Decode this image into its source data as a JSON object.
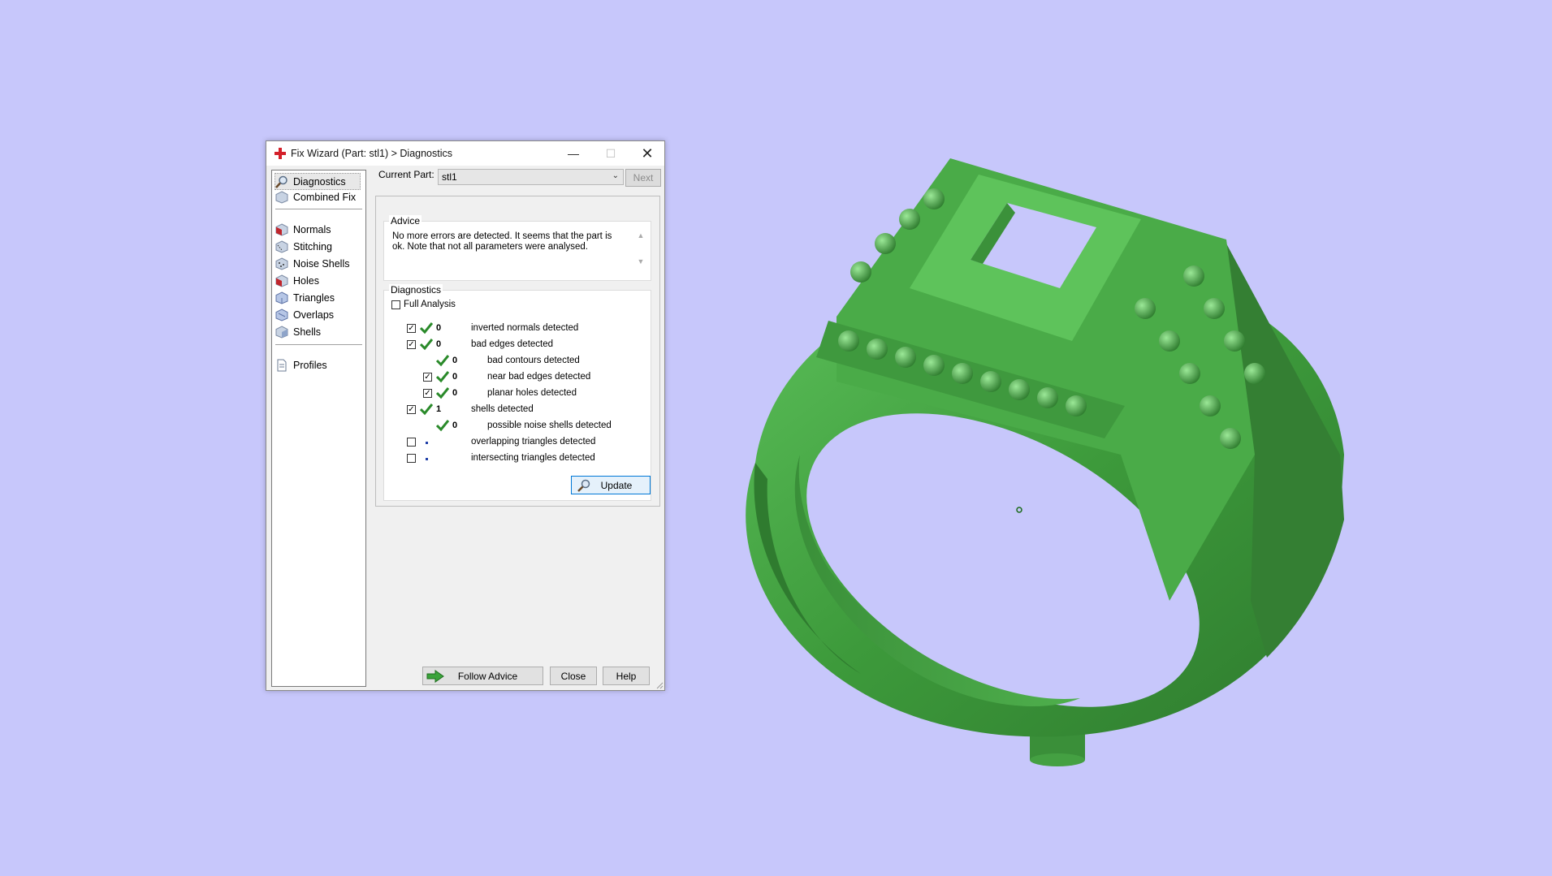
{
  "window": {
    "title": "Fix Wizard (Part: stl1) > Diagnostics",
    "minimize_glyph": "—",
    "maximize_glyph": "☐",
    "close_glyph": "✕"
  },
  "nav": {
    "items": [
      {
        "label": "Diagnostics",
        "icon": "magnifier-icon",
        "selected": true
      },
      {
        "label": "Combined Fix",
        "icon": "cube-icon"
      },
      {
        "label": "Normals",
        "icon": "normals-cube-icon"
      },
      {
        "label": "Stitching",
        "icon": "stitching-cube-icon"
      },
      {
        "label": "Noise Shells",
        "icon": "noise-shells-icon"
      },
      {
        "label": "Holes",
        "icon": "holes-cube-icon"
      },
      {
        "label": "Triangles",
        "icon": "triangles-cube-icon"
      },
      {
        "label": "Overlaps",
        "icon": "overlaps-cube-icon"
      },
      {
        "label": "Shells",
        "icon": "shells-cube-icon"
      },
      {
        "label": "Profiles",
        "icon": "document-icon"
      }
    ]
  },
  "part": {
    "label": "Current Part:",
    "value": "stl1",
    "next_label": "Next"
  },
  "advice": {
    "title": "Advice",
    "text": "No more errors are detected. It seems that the part is ok. Note that not all parameters were analysed."
  },
  "diagnostics": {
    "title": "Diagnostics",
    "full_analysis_label": "Full Analysis",
    "full_analysis_checked": false,
    "rows": [
      {
        "checked": true,
        "has_checkbox": true,
        "status": "ok",
        "count": "0",
        "label": "inverted normals detected",
        "indent": 0
      },
      {
        "checked": true,
        "has_checkbox": true,
        "status": "ok",
        "count": "0",
        "label": "bad edges detected",
        "indent": 0
      },
      {
        "checked": false,
        "has_checkbox": false,
        "status": "ok",
        "count": "0",
        "label": "bad contours detected",
        "indent": 1
      },
      {
        "checked": true,
        "has_checkbox": true,
        "status": "ok",
        "count": "0",
        "label": "near bad edges detected",
        "indent": 1
      },
      {
        "checked": true,
        "has_checkbox": true,
        "status": "ok",
        "count": "0",
        "label": "planar holes detected",
        "indent": 1
      },
      {
        "checked": true,
        "has_checkbox": true,
        "status": "ok",
        "count": "1",
        "label": "shells detected",
        "indent": 0
      },
      {
        "checked": false,
        "has_checkbox": false,
        "status": "ok",
        "count": "0",
        "label": "possible noise shells detected",
        "indent": 1
      },
      {
        "checked": false,
        "has_checkbox": true,
        "status": "none",
        "count": "",
        "label": "overlapping triangles detected",
        "indent": 0
      },
      {
        "checked": false,
        "has_checkbox": true,
        "status": "none",
        "count": "",
        "label": "intersecting triangles detected",
        "indent": 0
      }
    ],
    "update_label": "Update"
  },
  "footer": {
    "follow_advice_label": "Follow Advice",
    "close_label": "Close",
    "help_label": "Help"
  },
  "colors": {
    "background": "#c7c7fb",
    "model_green": "#3f9a3f",
    "check_green": "#2a8a2a"
  }
}
